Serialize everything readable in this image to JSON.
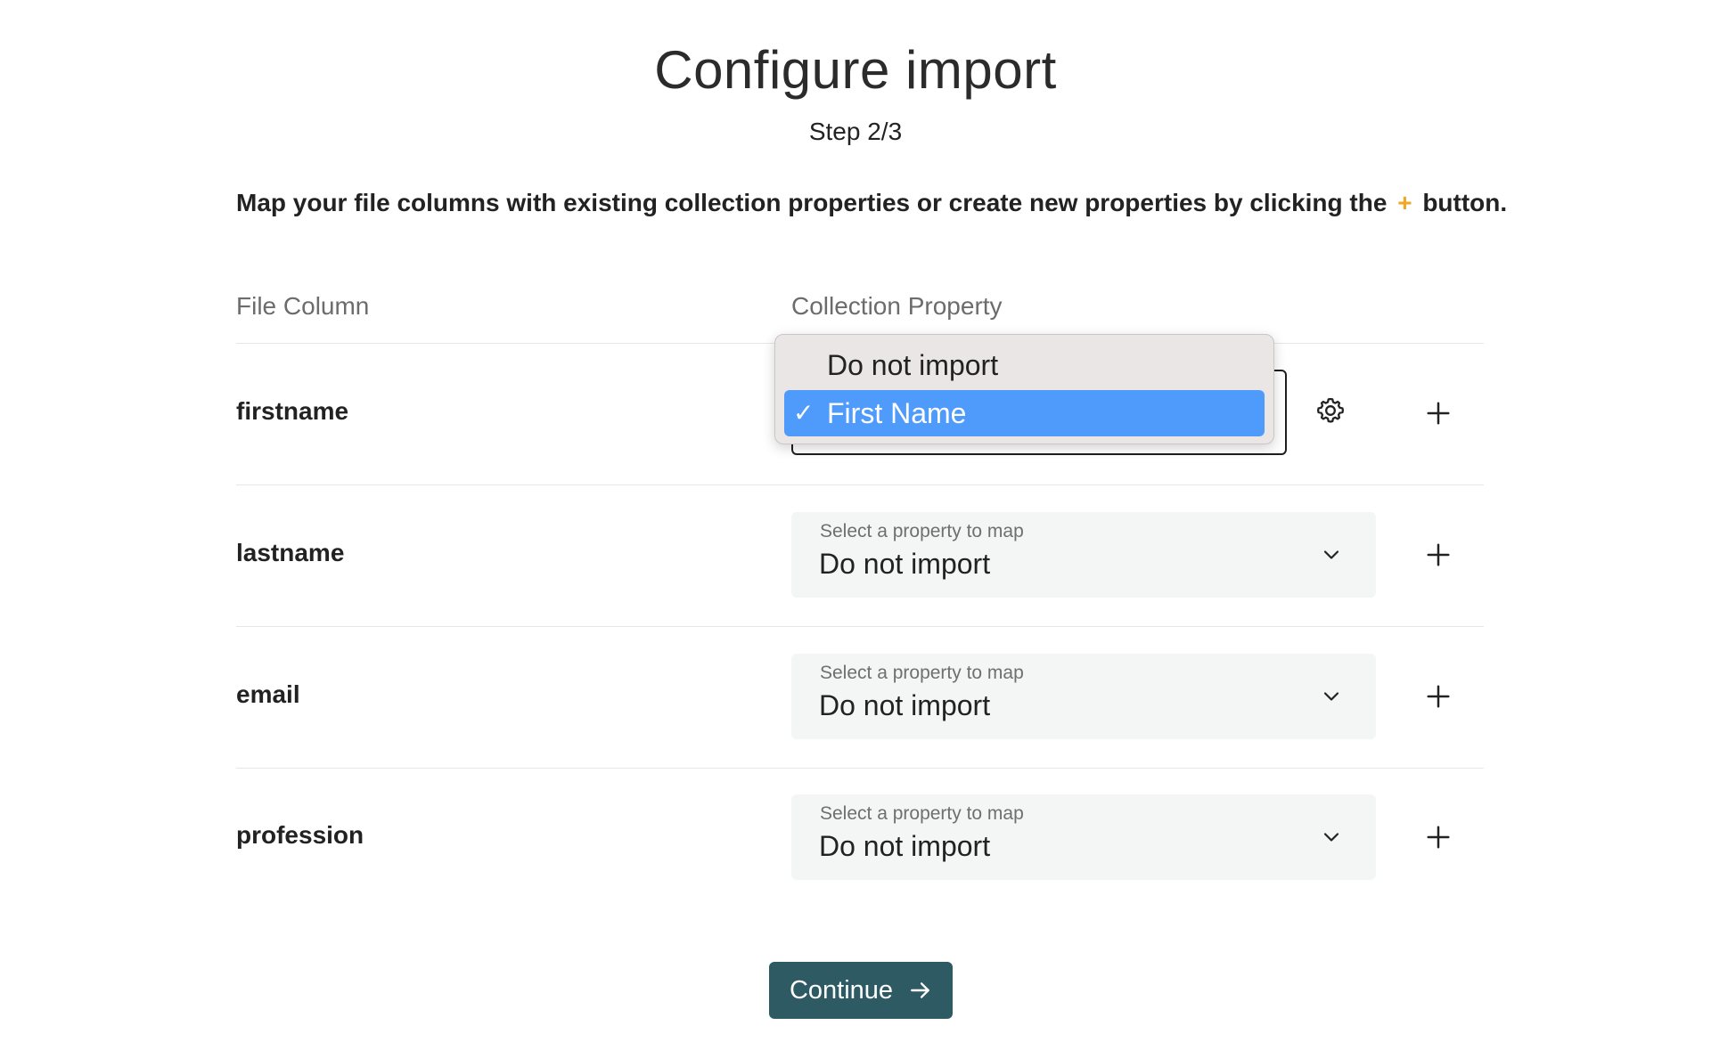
{
  "header": {
    "title": "Configure import",
    "step": "Step 2/3"
  },
  "instructions": {
    "before": "Map your file columns with existing collection properties or create new properties by clicking the",
    "accent": "+",
    "after": "button.",
    "accent_color": "#f2a623"
  },
  "columns": {
    "file_column": "File Column",
    "collection_property": "Collection Property"
  },
  "rows": [
    {
      "file_column": "firstname",
      "selected": "First Name",
      "dropdown_open": true
    },
    {
      "file_column": "lastname",
      "hint": "Select a property to map",
      "value": "Do not import"
    },
    {
      "file_column": "email",
      "hint": "Select a property to map",
      "value": "Do not import"
    },
    {
      "file_column": "profession",
      "hint": "Select a property to map",
      "value": "Do not import"
    }
  ],
  "dropdown": {
    "options": [
      "Do not import",
      "First Name"
    ],
    "selected_index": 1,
    "checkmark": "✓",
    "highlight_color": "#4f9bfb"
  },
  "icons": {
    "settings": "gear-icon",
    "add": "plus-icon",
    "expand": "chevron-down-icon",
    "continue": "arrow-right-icon"
  },
  "continue_button": {
    "label": "Continue",
    "color": "#2e5a63"
  }
}
